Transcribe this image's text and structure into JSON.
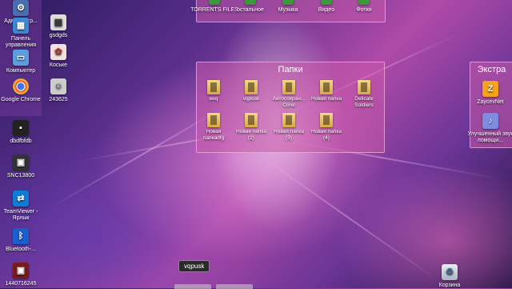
{
  "left_icons": [
    {
      "label": "Администр...",
      "icon": "admin-icon"
    },
    {
      "label": "Панель управления",
      "icon": "control-panel-icon"
    },
    {
      "label": "Компьютер",
      "icon": "computer-icon"
    },
    {
      "label": "Google Chrome",
      "icon": "chrome-icon"
    },
    {
      "label": "dbdfbfdb",
      "icon": "file-icon"
    },
    {
      "label": "SNC13800",
      "icon": "image-icon"
    },
    {
      "label": "TeamViewer - Ярлык",
      "icon": "teamviewer-icon"
    },
    {
      "label": "Bluetooth-...",
      "icon": "bluetooth-icon"
    },
    {
      "label": "1440716245",
      "icon": "image-icon"
    }
  ],
  "second_col_icons": [
    {
      "label": "gsdgds",
      "icon": "file-icon"
    },
    {
      "label": "Коське",
      "icon": "image-icon"
    },
    {
      "label": "243625",
      "icon": "image-icon"
    }
  ],
  "top_panel": {
    "items": [
      "TORRENTS FILES",
      "остальное",
      "Музыка",
      "Видео",
      "Фотки"
    ]
  },
  "folders_panel": {
    "title": "Папки",
    "items": [
      "eeq",
      "vqpusk",
      "Автосохран... Corel",
      "Новая папка",
      "Delicate Soldiers",
      "Новая папкаdfg",
      "Новая папка (2)",
      "Новая папка (3)",
      "Новая папка (4)"
    ]
  },
  "extra_panel": {
    "title": "Экстра",
    "items": [
      "ZaycevNet",
      "Улучшенный звук помощи..."
    ]
  },
  "recycle_bin": {
    "label": "Корзина"
  },
  "tooltip": {
    "text": "vqpusk"
  }
}
